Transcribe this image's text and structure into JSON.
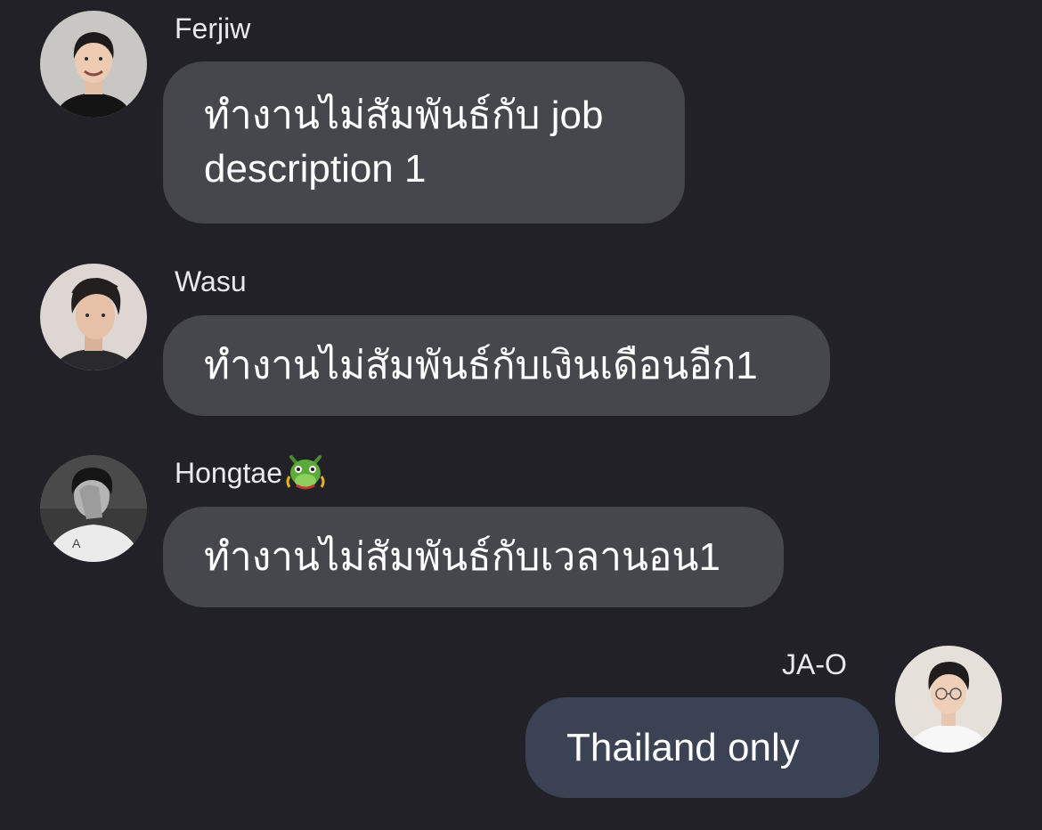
{
  "colors": {
    "background": "#212127",
    "incoming_bubble": "#46474d",
    "outgoing_bubble": "#3b4253",
    "text": "#ffffff",
    "sender_name": "#e9e9ee"
  },
  "messages": [
    {
      "sender": "Ferjiw",
      "text": "ทำงานไม่สัมพันธ์กับ job description 1",
      "avatar_icon": "profile-photo-ferjiw",
      "direction": "incoming"
    },
    {
      "sender": "Wasu",
      "text": "ทำงานไม่สัมพันธ์กับเงินเดือนอีก1",
      "avatar_icon": "profile-photo-wasu",
      "direction": "incoming"
    },
    {
      "sender": "Hongtae",
      "sender_emoji": "dragon-face-emoji",
      "text": "ทำงานไม่สัมพันธ์กับเวลานอน1",
      "avatar_icon": "profile-photo-hongtae",
      "direction": "incoming"
    },
    {
      "sender": "JA-O",
      "text": "Thailand only",
      "avatar_icon": "profile-photo-ja-o",
      "direction": "outgoing"
    }
  ]
}
